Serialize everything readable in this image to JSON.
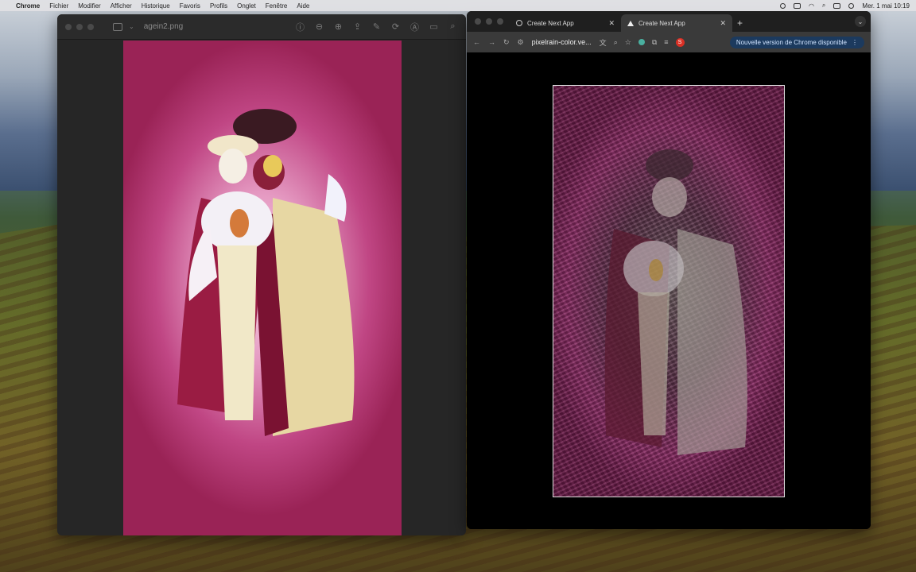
{
  "menubar": {
    "apple": "",
    "app_name": "Chrome",
    "items": [
      "Fichier",
      "Modifier",
      "Afficher",
      "Historique",
      "Favoris",
      "Profils",
      "Onglet",
      "Fenêtre",
      "Aide"
    ],
    "clock": "Mer. 1 mai  10:19"
  },
  "preview": {
    "filename": "agein2.png"
  },
  "chrome": {
    "tabs": [
      {
        "title": "Create Next App"
      },
      {
        "title": "Create Next App"
      }
    ],
    "new_tab": "+",
    "tab_menu": "⌄",
    "url": "pixelrain-color.ve...",
    "profile_initial": "S",
    "update_label": "Nouvelle version de Chrome disponible",
    "update_more": "⋮"
  }
}
